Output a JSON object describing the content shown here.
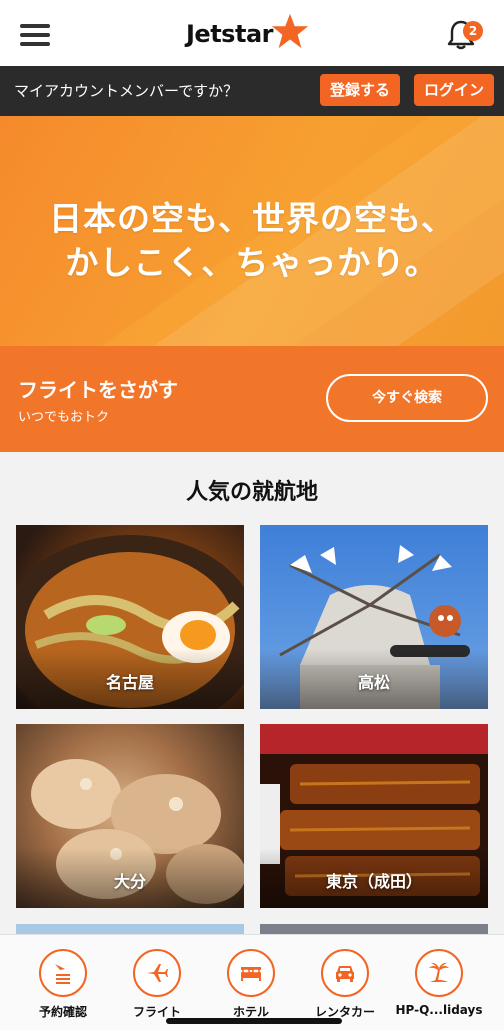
{
  "header": {
    "logo_text": "Jetstar",
    "notification_count": "2"
  },
  "account": {
    "question": "マイアカウントメンバーですか？",
    "register_label": "登録する",
    "login_label": "ログイン"
  },
  "hero": {
    "line1": "日本の空も、世界の空も、",
    "line2": "かしこく、ちゃっかり。"
  },
  "flight_search": {
    "title": "フライトをさがす",
    "subtitle": "いつでもおトク",
    "button_label": "今すぐ検索"
  },
  "popular": {
    "title": "人気の就航地",
    "destinations": [
      {
        "label": "名古屋"
      },
      {
        "label": "高松"
      },
      {
        "label": "大分"
      },
      {
        "label": "東京（成田）"
      }
    ]
  },
  "tabs": [
    {
      "label": "予約確認",
      "icon": "booking-icon"
    },
    {
      "label": "フライト",
      "icon": "plane-icon"
    },
    {
      "label": "ホテル",
      "icon": "bed-icon"
    },
    {
      "label": "レンタカー",
      "icon": "car-icon"
    },
    {
      "label": "HP-Q...lidays",
      "icon": "palm-tree-icon"
    }
  ],
  "colors": {
    "brand_orange": "#f26522",
    "dark_strip": "#2b2b2b"
  }
}
